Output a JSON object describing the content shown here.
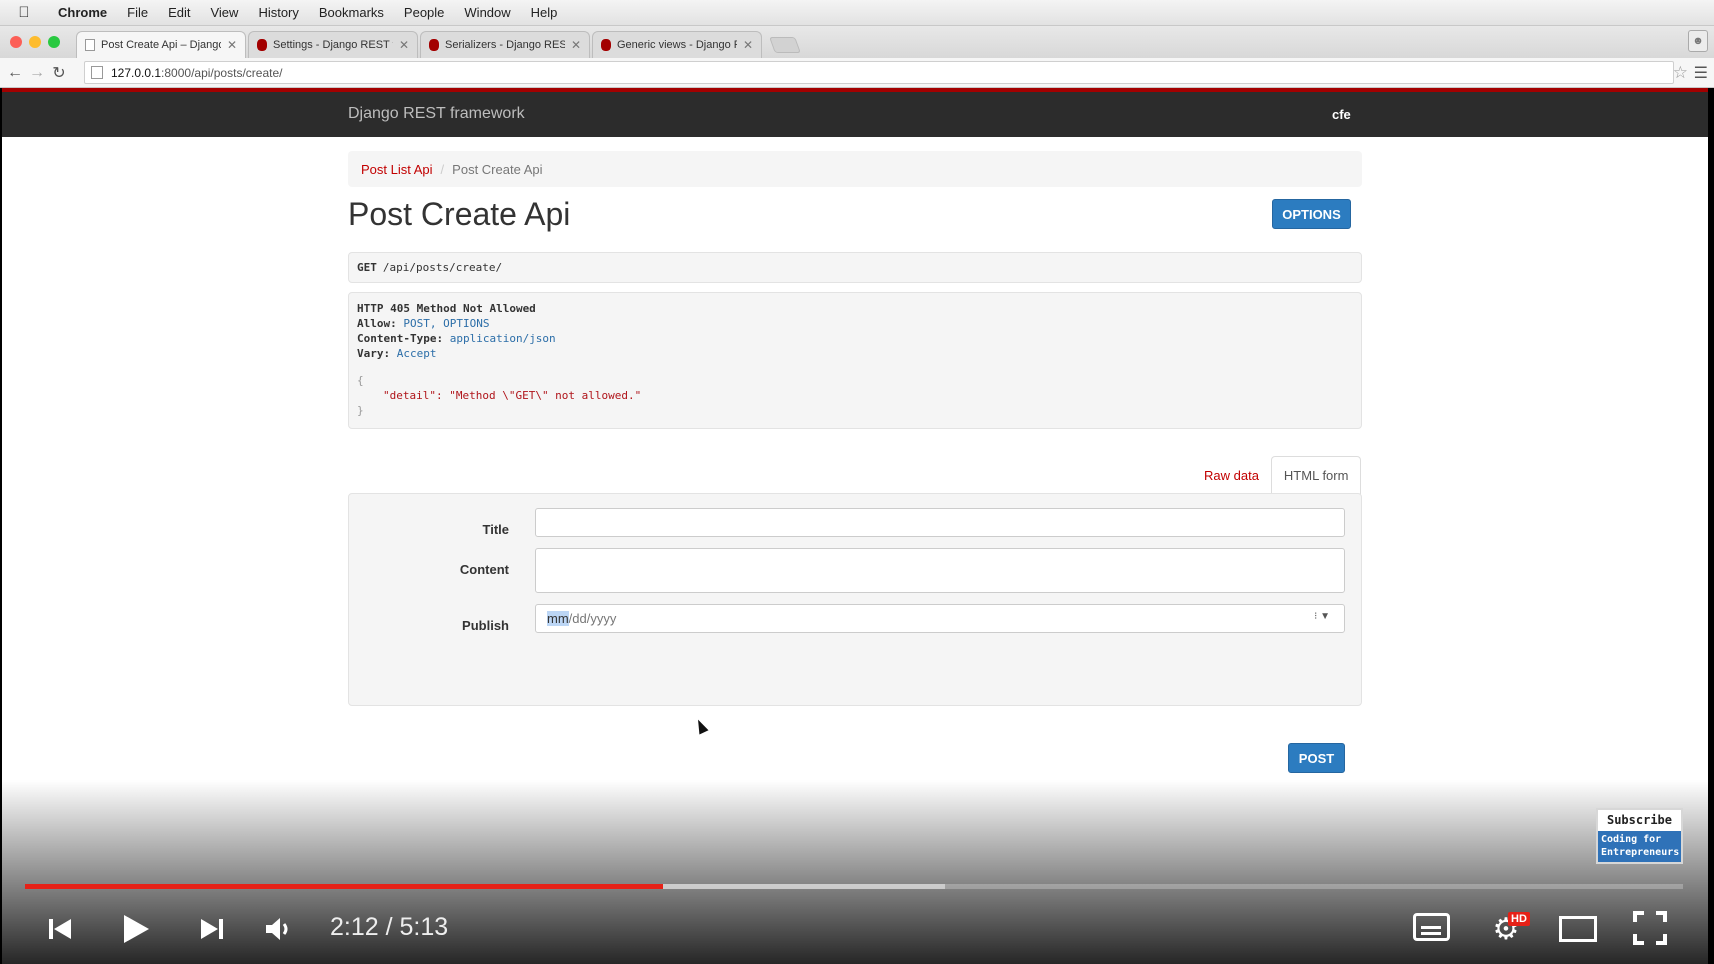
{
  "menubar": {
    "app": "Chrome",
    "items": [
      "File",
      "Edit",
      "View",
      "History",
      "Bookmarks",
      "People",
      "Window",
      "Help"
    ]
  },
  "tabs": [
    {
      "label": "Post Create Api – Django R"
    },
    {
      "label": "Settings - Django REST fra"
    },
    {
      "label": "Serializers - Django REST f"
    },
    {
      "label": "Generic views - Django RE"
    }
  ],
  "address": {
    "host": "127.0.0.1",
    "path": ":8000/api/posts/create/"
  },
  "drf": {
    "brand": "Django REST framework",
    "user": "cfe"
  },
  "breadcrumb": {
    "link": "Post List Api",
    "separator": "/",
    "current": "Post Create Api"
  },
  "page_title": "Post Create Api",
  "options_label": "OPTIONS",
  "request": {
    "method": "GET",
    "path": "/api/posts/create/"
  },
  "response": {
    "status": "HTTP 405 Method Not Allowed",
    "allow_key": "Allow:",
    "allow_val": "POST, OPTIONS",
    "ctype_key": "Content-Type:",
    "ctype_val": "application/json",
    "vary_key": "Vary:",
    "vary_val": "Accept",
    "open_brace": "{",
    "body_line": "\"detail\": \"Method \\\"GET\\\" not allowed.\"",
    "close_brace": "}"
  },
  "form_tabs": {
    "raw": "Raw data",
    "html": "HTML form"
  },
  "form": {
    "title_label": "Title",
    "content_label": "Content",
    "publish_label": "Publish",
    "publish_placeholder_mm": "mm",
    "publish_placeholder_rest": "/dd/yyyy",
    "date_controls": "⁝ ▼",
    "post_label": "POST"
  },
  "player": {
    "time": "2:12 / 5:13",
    "played_fraction": 0.385,
    "buffered_fraction": 0.555,
    "hd_badge": "HD",
    "subscribe": "Subscribe",
    "channel": "Coding for Entrepreneurs"
  },
  "colors": {
    "accent": "#c20000",
    "primary_button": "#2c7cc0",
    "progress": "#e62117"
  }
}
